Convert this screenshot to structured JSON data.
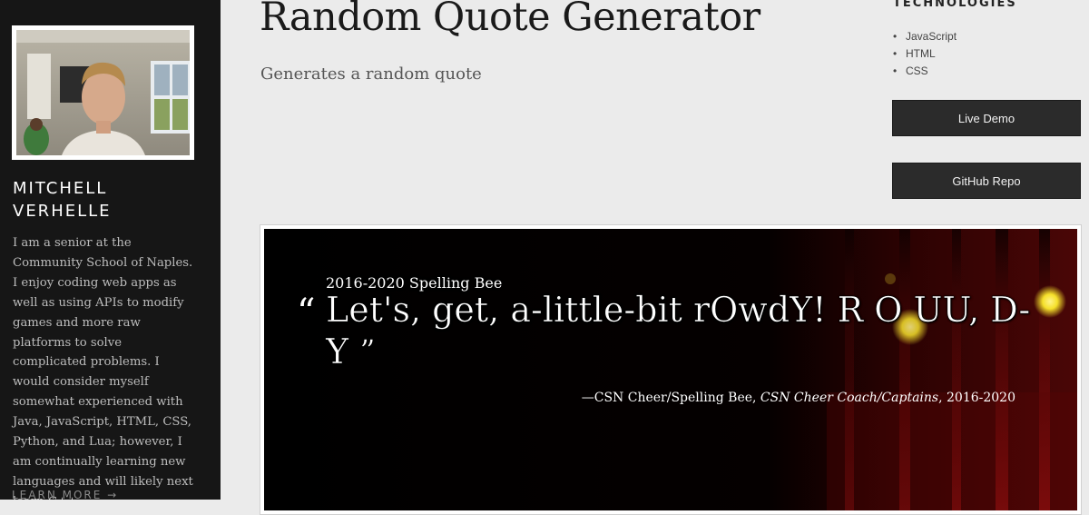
{
  "sidebar": {
    "name_line1": "MITCHELL",
    "name_line2": "VERHELLE",
    "bio": "I am a senior at the Community School of Naples. I enjoy coding web apps as well as using APIs to modify games and more raw platforms to solve complicated problems. I would consider myself somewhat experienced with Java, JavaScript, HTML, CSS, Python, and Lua; however, I am continually learning new languages and will likely next learn C++.",
    "learn_more": "LEARN MORE →"
  },
  "main": {
    "title": "Random Quote Generator",
    "subtitle": "Generates a random quote"
  },
  "technologies": {
    "heading": "TECHNOLOGIES",
    "items": [
      "JavaScript",
      "HTML",
      "CSS"
    ]
  },
  "buttons": {
    "live_demo": "Live Demo",
    "github_repo": "GitHub Repo"
  },
  "screenshot": {
    "source": "2016-2020 Spelling Bee",
    "open_quote": "“",
    "quote": "Let's, get, a-little-bit rOwdY! R O UU, D-Y",
    "close_quote": "”",
    "attribution_prefix": "—CSN Cheer/Spelling Bee, ",
    "attribution_italic": "CSN Cheer Coach/Captains",
    "attribution_suffix": ", 2016-2020"
  },
  "colors": {
    "sidebar_bg": "#161616",
    "page_bg": "#ebebeb",
    "button_bg": "#2b2b2b",
    "stage_light": "#f5e02a"
  }
}
